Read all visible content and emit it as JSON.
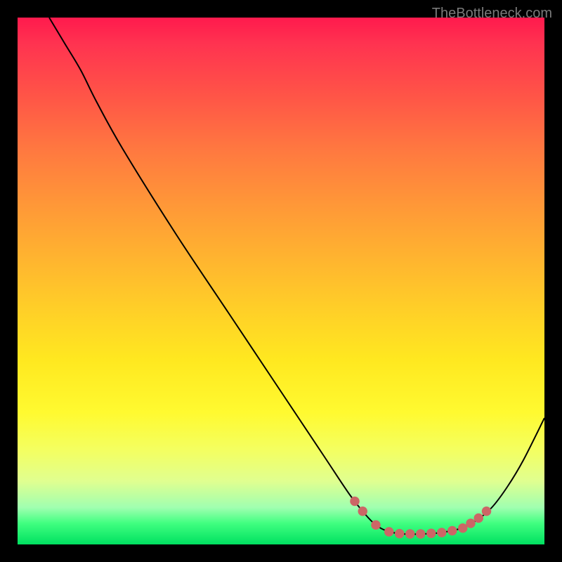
{
  "watermark_text": "TheBottleneck.com",
  "chart_data": {
    "type": "line",
    "title": "",
    "xlabel": "",
    "ylabel": "",
    "xlim": [
      0,
      100
    ],
    "ylim": [
      0,
      100
    ],
    "curve": {
      "name": "bottleneck-curve",
      "points": [
        {
          "x": 6.0,
          "y": 100.0
        },
        {
          "x": 9.0,
          "y": 95.0
        },
        {
          "x": 12.0,
          "y": 90.0
        },
        {
          "x": 15.0,
          "y": 84.0
        },
        {
          "x": 20.0,
          "y": 75.0
        },
        {
          "x": 30.0,
          "y": 59.0
        },
        {
          "x": 40.0,
          "y": 44.0
        },
        {
          "x": 50.0,
          "y": 29.0
        },
        {
          "x": 58.0,
          "y": 17.0
        },
        {
          "x": 63.0,
          "y": 9.5
        },
        {
          "x": 66.0,
          "y": 5.7
        },
        {
          "x": 68.0,
          "y": 3.7
        },
        {
          "x": 70.0,
          "y": 2.6
        },
        {
          "x": 73.0,
          "y": 2.0
        },
        {
          "x": 77.0,
          "y": 2.0
        },
        {
          "x": 80.0,
          "y": 2.2
        },
        {
          "x": 84.0,
          "y": 3.0
        },
        {
          "x": 87.0,
          "y": 4.5
        },
        {
          "x": 90.0,
          "y": 7.0
        },
        {
          "x": 93.0,
          "y": 11.0
        },
        {
          "x": 96.0,
          "y": 16.0
        },
        {
          "x": 100.0,
          "y": 24.0
        }
      ]
    },
    "highlight_dots": {
      "name": "optimal-range-dots",
      "color": "#cc6666",
      "points": [
        {
          "x": 64.0,
          "y": 8.2
        },
        {
          "x": 65.5,
          "y": 6.3
        },
        {
          "x": 68.0,
          "y": 3.7
        },
        {
          "x": 70.5,
          "y": 2.4
        },
        {
          "x": 72.5,
          "y": 2.05
        },
        {
          "x": 74.5,
          "y": 2.0
        },
        {
          "x": 76.5,
          "y": 2.0
        },
        {
          "x": 78.5,
          "y": 2.1
        },
        {
          "x": 80.5,
          "y": 2.25
        },
        {
          "x": 82.5,
          "y": 2.6
        },
        {
          "x": 84.5,
          "y": 3.1
        },
        {
          "x": 86.0,
          "y": 4.0
        },
        {
          "x": 87.5,
          "y": 5.0
        },
        {
          "x": 89.0,
          "y": 6.3
        }
      ]
    }
  }
}
